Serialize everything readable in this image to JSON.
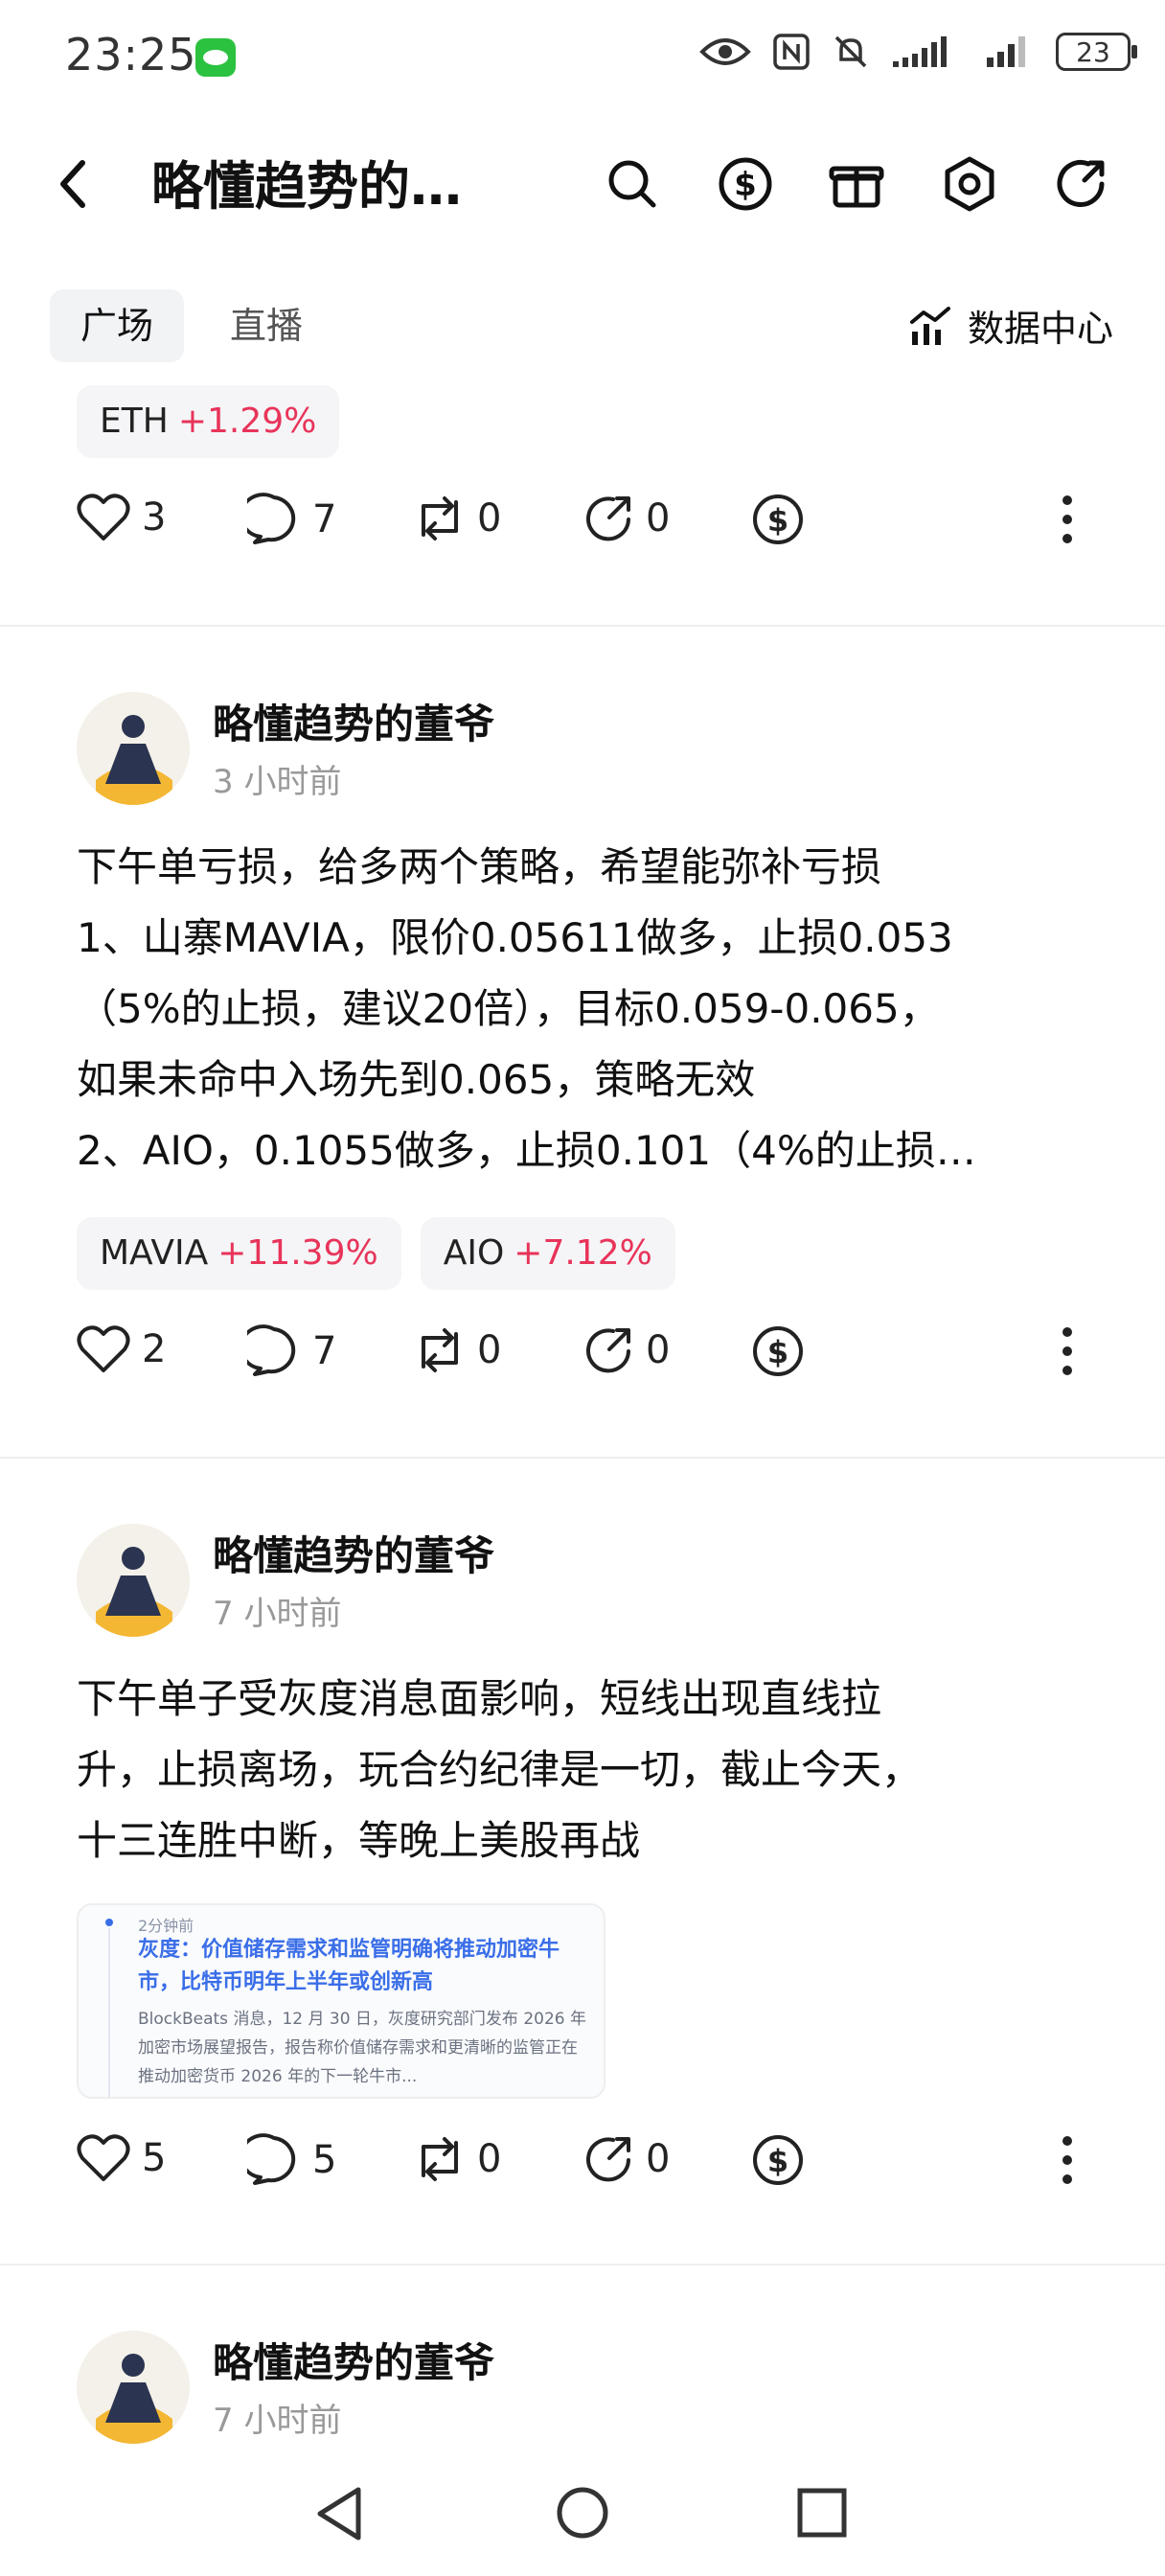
{
  "status_bar": {
    "time": "23:25",
    "battery": "23"
  },
  "header": {
    "title": "略懂趋势的…"
  },
  "tabs": {
    "items": [
      "广场",
      "直播"
    ],
    "data_center": "数据中心"
  },
  "post0": {
    "chip": {
      "symbol": "ETH",
      "change": "+1.29%"
    },
    "likes": "3",
    "comments": "7",
    "reposts": "0",
    "shares": "0"
  },
  "post1": {
    "author": "略懂趋势的董爷",
    "time": "3 小时前",
    "lines": [
      "下午单亏损，给多两个策略，希望能弥补亏损",
      "1、山寨MAVIA，限价0.05611做多，止损0.053",
      "（5%的止损，建议20倍），目标0.059-0.065，",
      "如果未命中入场先到0.065，策略无效",
      "2、AIO，0.1055做多，止损0.101（4%的止损…"
    ],
    "chips": [
      {
        "symbol": "MAVIA",
        "change": "+11.39%"
      },
      {
        "symbol": "AIO",
        "change": "+7.12%"
      }
    ],
    "likes": "2",
    "comments": "7",
    "reposts": "0",
    "shares": "0"
  },
  "post2": {
    "author": "略懂趋势的董爷",
    "time": "7 小时前",
    "lines": [
      "下午单子受灰度消息面影响，短线出现直线拉",
      "升，止损离场，玩合约纪律是一切，截止今天，",
      "十三连胜中断，等晚上美股再战"
    ],
    "news": {
      "time": "2分钟前",
      "title": "灰度：价值储存需求和监管明确将推动加密牛市，比特币明年上半年或创新高",
      "body": "BlockBeats 消息，12 月 30 日，灰度研究部门发布 2026 年加密市场展望报告，报告称价值储存需求和更清晰的监管正在推动加密货币 2026 年的下一轮牛市..."
    },
    "likes": "5",
    "comments": "5",
    "reposts": "0",
    "shares": "0"
  },
  "post3": {
    "author": "略懂趋势的董爷",
    "time": "7 小时前"
  },
  "colors": {
    "up": "#e8345a",
    "link": "#3a6ee8"
  },
  "icons": [
    "eye-icon",
    "nfc-icon",
    "mute-icon",
    "signal-icon",
    "search-icon",
    "dollar-icon",
    "gift-icon",
    "settings-icon",
    "share-icon",
    "heart-icon",
    "comment-icon",
    "repost-icon",
    "forward-icon",
    "tip-icon",
    "more-icon",
    "chart-icon",
    "back-icon"
  ]
}
